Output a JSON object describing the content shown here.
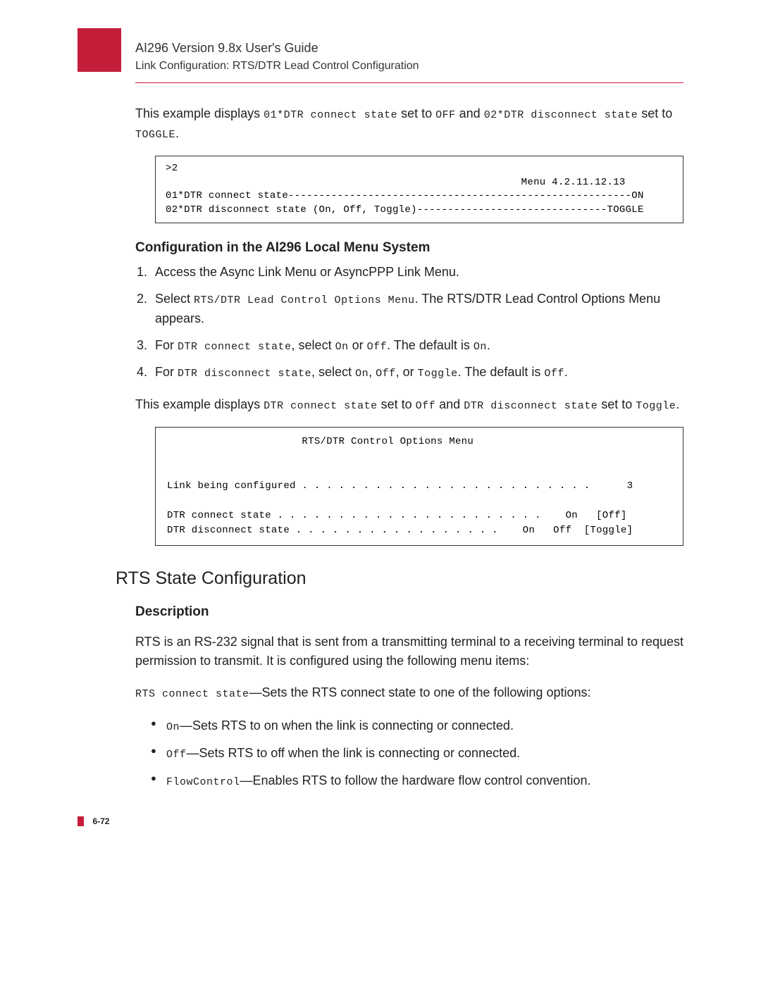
{
  "header": {
    "title": "AI296 Version 9.8x User's Guide",
    "breadcrumb": "Link Configuration: RTS/DTR Lead Control Configuration"
  },
  "intro": {
    "p1_prefix": "This example displays ",
    "p1_code1": "01*DTR connect state",
    "p1_mid1": " set to ",
    "p1_code2": "OFF",
    "p1_mid2": " and ",
    "p1_code3": "02*DTR disconnect state",
    "p1_mid3": " set to ",
    "p1_code4": "TOGGLE",
    "p1_suffix": "."
  },
  "codebox1": ">2\n                                                          Menu 4.2.11.12.13\n01*DTR connect state--------------------------------------------------------ON\n02*DTR disconnect state (On, Off, Toggle)-------------------------------TOGGLE",
  "subheading1": "Configuration in the AI296 Local Menu System",
  "steps": {
    "s1": "Access the Async Link Menu or AsyncPPP Link Menu.",
    "s2_prefix": "Select ",
    "s2_code": "RTS/DTR Lead Control Options Menu",
    "s2_suffix": ". The RTS/DTR Lead Control Options Menu appears.",
    "s3_prefix": "For ",
    "s3_code1": "DTR connect state",
    "s3_mid1": ", select ",
    "s3_code2": "On",
    "s3_mid2": " or ",
    "s3_code3": "Off",
    "s3_mid3": ". The default is ",
    "s3_code4": "On",
    "s3_suffix": ".",
    "s4_prefix": "For ",
    "s4_code1": "DTR disconnect state",
    "s4_mid1": ", select ",
    "s4_code2": "On",
    "s4_mid2": ", ",
    "s4_code3": "Off",
    "s4_mid3": ", or ",
    "s4_code4": "Toggle",
    "s4_mid4": ". The default is ",
    "s4_code5": "Off",
    "s4_suffix": "."
  },
  "example2": {
    "prefix": "This example displays ",
    "code1": "DTR connect state",
    "mid1": " set to ",
    "code2": "Off",
    "mid2": " and ",
    "code3": "DTR disconnect state",
    "mid3": " set to ",
    "code4": "Toggle",
    "suffix": "."
  },
  "codebox2": "                      RTS/DTR Control Options Menu\n\n\nLink being configured . . . . . . . . . . . . . . . . . . . . . . . .      3\n\nDTR connect state . . . . . . . . . . . . . . . . . . . . . .    On   [Off]\nDTR disconnect state . . . . . . . . . . . . . . . . .    On   Off  [Toggle]",
  "h2": "RTS State Configuration",
  "desc": {
    "heading": "Description",
    "p1": "RTS is an RS-232 signal that is sent from a transmitting terminal to a receiving terminal to request permission to transmit. It is configured using the following menu items:",
    "p2_code": "RTS connect state",
    "p2_text": "—Sets the RTS connect state to one of the following options:"
  },
  "options": {
    "o1_code": "On",
    "o1_text": "—Sets RTS to on when the link is connecting or connected.",
    "o2_code": "Off",
    "o2_text": "—Sets RTS to off when the link is connecting or connected.",
    "o3_code": "FlowControl",
    "o3_text": "—Enables RTS to follow the hardware flow control convention."
  },
  "page_number": "6-72"
}
